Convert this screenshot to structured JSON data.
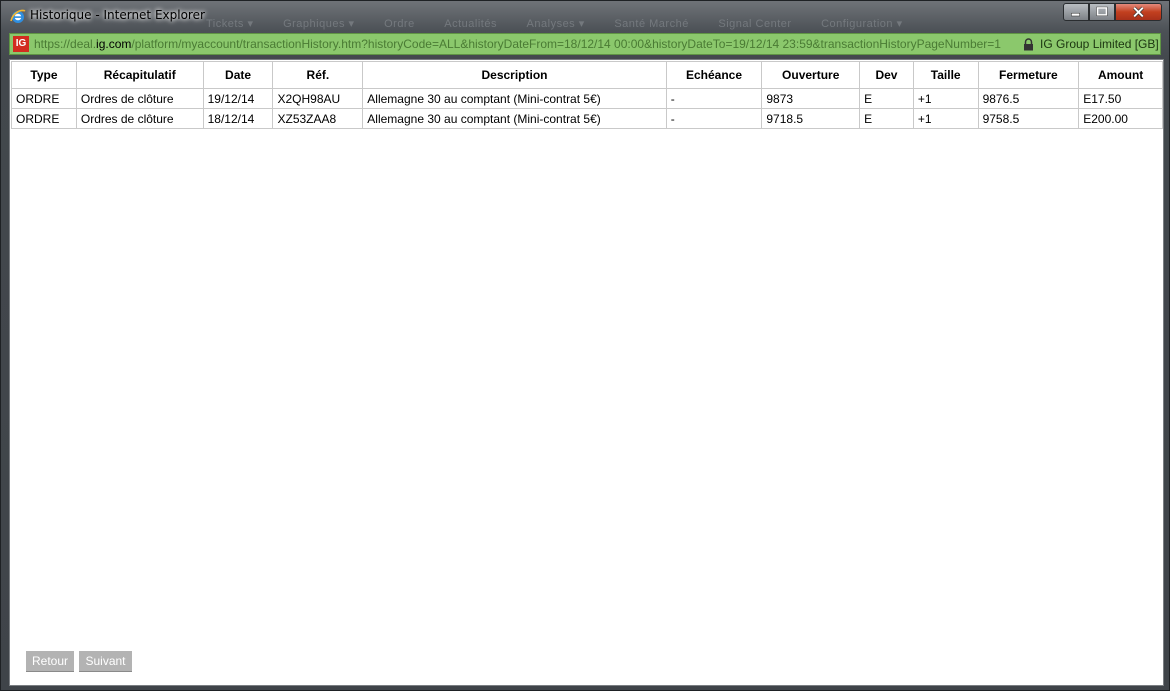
{
  "window": {
    "title": "Historique - Internet Explorer"
  },
  "background_menu": [
    "Tickets ▾",
    "Graphiques ▾",
    "Ordre",
    "Actualités",
    "Analyses ▾",
    "Santé Marché",
    "Signal Center",
    "Configuration ▾"
  ],
  "addressbar": {
    "logo_text": "IG",
    "url_prefix": "https://deal.",
    "url_domain": "ig.com",
    "url_path": "/platform/myaccount/transactionHistory.htm?historyCode=ALL&historyDateFrom=18/12/14 00:00&historyDateTo=19/12/14 23:59&transactionHistoryPageNumber=1",
    "certificate": "IG Group Limited [GB]"
  },
  "table": {
    "headers": [
      "Type",
      "Récapitulatif",
      "Date",
      "Réf.",
      "Description",
      "Echéance",
      "Ouverture",
      "Dev",
      "Taille",
      "Fermeture",
      "Amount"
    ],
    "rows": [
      [
        "ORDRE",
        "Ordres de clôture",
        "19/12/14",
        "X2QH98AU",
        "Allemagne 30 au comptant (Mini-contrat 5€)",
        "-",
        "9873",
        "E",
        "+1",
        "9876.5",
        "E17.50"
      ],
      [
        "ORDRE",
        "Ordres de clôture",
        "18/12/14",
        "XZ53ZAA8",
        "Allemagne 30 au comptant (Mini-contrat 5€)",
        "-",
        "9718.5",
        "E",
        "+1",
        "9758.5",
        "E200.00"
      ]
    ]
  },
  "pagination": {
    "prev_label": "Retour",
    "next_label": "Suivant"
  },
  "colors": {
    "address_bar": "#8bc86c",
    "close_button": "#c2401f",
    "brand": "#d22c1f",
    "pagination_button": "#b3b3b3"
  }
}
